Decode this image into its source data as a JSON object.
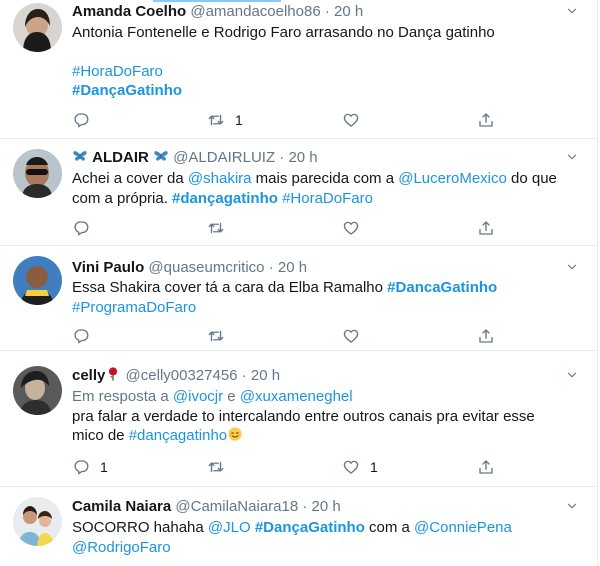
{
  "tweets": [
    {
      "name": "Amanda Coelho",
      "handle": "@amandacoelho86",
      "dot": "·",
      "time": "20 h",
      "line1": "Antonia Fontenelle e Rodrigo Faro arrasando no Dança gatinho",
      "tag1": "#HoraDoFaro",
      "tag2": "#DançaGatinho",
      "reply_count": "",
      "retweet_count": "1",
      "like_count": ""
    },
    {
      "name": "ALDAIR",
      "handle": "@ALDAIRLUIZ",
      "dot": "·",
      "time": "20 h",
      "p1": "Achei a cover da ",
      "m1": "@shakira",
      "p2": " mais parecida com a ",
      "m2": "@LuceroMexico",
      "p3": " do que",
      "p4": "com a própria. ",
      "tag1": "#dançagatinho",
      "tag2": "#HoraDoFaro",
      "reply_count": "",
      "retweet_count": "",
      "like_count": ""
    },
    {
      "name": "Vini Paulo",
      "handle": "@quaseumcritico",
      "dot": "·",
      "time": "20 h",
      "p1": "Essa Shakira cover tá a cara da Elba Ramalho ",
      "tag1": "#DancaGatinho",
      "tag2": "#ProgramaDoFaro",
      "reply_count": "",
      "retweet_count": "",
      "like_count": ""
    },
    {
      "name": "celly",
      "handle": "@celly00327456",
      "dot": "·",
      "time": "20 h",
      "reply_prefix": "Em resposta a ",
      "m1": "@ivocjr",
      "and": " e ",
      "m2": "@xuxameneghel",
      "line1": "pra falar a verdade to intercalando entre outros canais pra evitar esse",
      "p2": "mico de ",
      "tag1": "#dançagatinho",
      "reply_count": "1",
      "retweet_count": "",
      "like_count": "1"
    },
    {
      "name": "Camila Naiara",
      "handle": "@CamilaNaiara18",
      "dot": "·",
      "time": "20 h",
      "p1": "SOCORRO hahaha ",
      "m1": "@JLO",
      "sp": " ",
      "tag1": "#DançaGatinho",
      "p2": " com a ",
      "m2": "@ConniePena",
      "m3": "@RodrigoFaro"
    }
  ],
  "icons": {
    "reply": "reply-icon",
    "retweet": "retweet-icon",
    "like": "heart-icon",
    "share": "share-icon",
    "caret": "chevron-down-icon"
  },
  "colors": {
    "link": "#1b95e0",
    "secondary": "#657786",
    "text": "#14171a",
    "divider": "#e6ecf0"
  }
}
